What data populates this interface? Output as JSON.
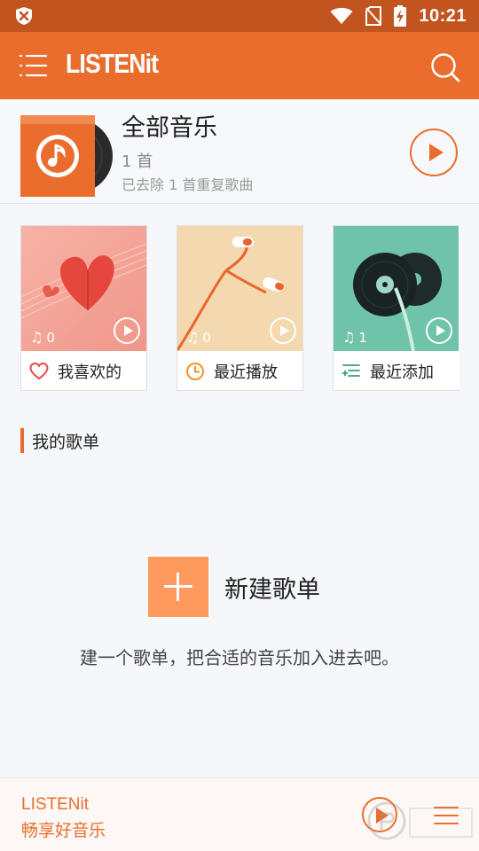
{
  "status_bar": {
    "time": "10:21"
  },
  "app_bar": {
    "title": "LISTENit"
  },
  "all_music": {
    "name": "全部音乐",
    "count": "1 首",
    "removed_note": "已去除 1 首重复歌曲"
  },
  "cards": [
    {
      "label": "我喜欢的",
      "count": "0",
      "icon": "heart-icon"
    },
    {
      "label": "最近播放",
      "count": "0",
      "icon": "clock-icon"
    },
    {
      "label": "最近添加",
      "count": "1",
      "icon": "list-add-icon"
    }
  ],
  "section": {
    "title": "我的歌单"
  },
  "new_playlist": {
    "label": "新建歌单",
    "hint": "建一个歌单，把合适的音乐加入进去吧。"
  },
  "player": {
    "title": "LISTENit",
    "subtitle": "畅享好音乐"
  },
  "colors": {
    "accent": "#ea6d2e",
    "status_bar": "#c2541f",
    "add_button": "#ff9a5e"
  }
}
